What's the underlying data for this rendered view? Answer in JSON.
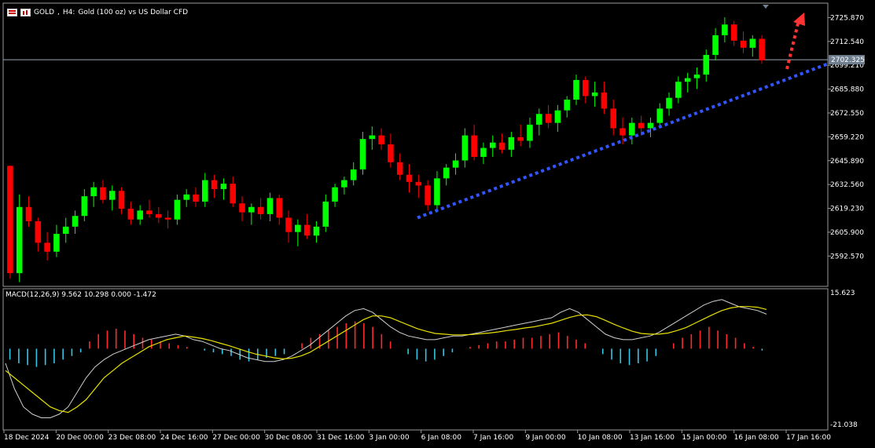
{
  "header": {
    "symbol": "GOLD",
    "timeframe": "H4:",
    "description": "Gold (100 oz) vs US Dollar CFD"
  },
  "chart_data": [
    {
      "type": "candlestick",
      "series_name": "GOLD",
      "ylim": [
        2580,
        2730
      ],
      "price_ticks": [
        "2725.870",
        "2712.540",
        "2699.210",
        "2685.880",
        "2672.550",
        "2659.220",
        "2645.890",
        "2632.560",
        "2619.230",
        "2605.900",
        "2592.570"
      ],
      "current_price": "2702.325",
      "x_tick_labels": [
        "18 Dec 2024",
        "20 Dec 00:00",
        "23 Dec 08:00",
        "24 Dec 16:00",
        "27 Dec 00:00",
        "30 Dec 08:00",
        "31 Dec 16:00",
        "3 Jan 00:00",
        "6 Jan 08:00",
        "7 Jan 16:00",
        "9 Jan 00:00",
        "10 Jan 08:00",
        "13 Jan 16:00",
        "15 Jan 00:00",
        "16 Jan 08:00",
        "17 Jan 16:00"
      ],
      "colors": {
        "bull": "#00ff00",
        "bear": "#ff0000",
        "trendline": "#3355ff",
        "arrow": "#ff3333"
      },
      "trendline": {
        "style": "dotted",
        "from_price": 2614,
        "to_price": 2700
      },
      "forecast_arrow": "up",
      "candles": [
        [
          2643,
          2643,
          2580,
          2583
        ],
        [
          2583,
          2627,
          2578,
          2620
        ],
        [
          2620,
          2626,
          2609,
          2612
        ],
        [
          2612,
          2614,
          2595,
          2600
        ],
        [
          2600,
          2606,
          2590,
          2595
        ],
        [
          2595,
          2610,
          2592,
          2605
        ],
        [
          2605,
          2614,
          2600,
          2609
        ],
        [
          2609,
          2618,
          2605,
          2615
        ],
        [
          2615,
          2630,
          2612,
          2626
        ],
        [
          2626,
          2634,
          2620,
          2631
        ],
        [
          2631,
          2635,
          2622,
          2624
        ],
        [
          2624,
          2632,
          2618,
          2629
        ],
        [
          2629,
          2631,
          2616,
          2619
        ],
        [
          2619,
          2623,
          2610,
          2613
        ],
        [
          2613,
          2621,
          2610,
          2618
        ],
        [
          2618,
          2624,
          2614,
          2616
        ],
        [
          2616,
          2620,
          2611,
          2614
        ],
        [
          2614,
          2618,
          2608,
          2613
        ],
        [
          2613,
          2627,
          2610,
          2624
        ],
        [
          2624,
          2630,
          2620,
          2627
        ],
        [
          2627,
          2631,
          2620,
          2623
        ],
        [
          2623,
          2639,
          2620,
          2635
        ],
        [
          2635,
          2638,
          2625,
          2630
        ],
        [
          2630,
          2636,
          2624,
          2633
        ],
        [
          2633,
          2637,
          2620,
          2622
        ],
        [
          2622,
          2626,
          2612,
          2617
        ],
        [
          2617,
          2622,
          2610,
          2620
        ],
        [
          2620,
          2625,
          2613,
          2616
        ],
        [
          2616,
          2628,
          2612,
          2625
        ],
        [
          2625,
          2627,
          2610,
          2614
        ],
        [
          2614,
          2618,
          2600,
          2606
        ],
        [
          2606,
          2613,
          2598,
          2610
        ],
        [
          2610,
          2616,
          2602,
          2604
        ],
        [
          2604,
          2612,
          2600,
          2609
        ],
        [
          2609,
          2627,
          2606,
          2623
        ],
        [
          2623,
          2633,
          2620,
          2631
        ],
        [
          2631,
          2637,
          2627,
          2635
        ],
        [
          2635,
          2645,
          2632,
          2641
        ],
        [
          2641,
          2662,
          2638,
          2658
        ],
        [
          2658,
          2665,
          2652,
          2660
        ],
        [
          2660,
          2664,
          2652,
          2655
        ],
        [
          2655,
          2661,
          2642,
          2645
        ],
        [
          2645,
          2650,
          2635,
          2638
        ],
        [
          2638,
          2644,
          2628,
          2634
        ],
        [
          2634,
          2638,
          2625,
          2632
        ],
        [
          2632,
          2635,
          2618,
          2621
        ],
        [
          2621,
          2640,
          2617,
          2636
        ],
        [
          2636,
          2644,
          2632,
          2642
        ],
        [
          2642,
          2650,
          2638,
          2646
        ],
        [
          2646,
          2664,
          2642,
          2660
        ],
        [
          2660,
          2666,
          2646,
          2648
        ],
        [
          2648,
          2656,
          2644,
          2653
        ],
        [
          2653,
          2660,
          2648,
          2656
        ],
        [
          2656,
          2661,
          2650,
          2652
        ],
        [
          2652,
          2662,
          2648,
          2659
        ],
        [
          2659,
          2666,
          2654,
          2657
        ],
        [
          2657,
          2670,
          2653,
          2666
        ],
        [
          2666,
          2675,
          2660,
          2672
        ],
        [
          2672,
          2677,
          2664,
          2667
        ],
        [
          2667,
          2677,
          2662,
          2674
        ],
        [
          2674,
          2682,
          2670,
          2680
        ],
        [
          2680,
          2694,
          2677,
          2691
        ],
        [
          2691,
          2693,
          2678,
          2682
        ],
        [
          2682,
          2690,
          2676,
          2684
        ],
        [
          2684,
          2690,
          2672,
          2675
        ],
        [
          2675,
          2680,
          2660,
          2664
        ],
        [
          2664,
          2670,
          2655,
          2660
        ],
        [
          2660,
          2670,
          2655,
          2667
        ],
        [
          2667,
          2671,
          2660,
          2664
        ],
        [
          2664,
          2670,
          2659,
          2667
        ],
        [
          2667,
          2678,
          2664,
          2675
        ],
        [
          2675,
          2684,
          2671,
          2681
        ],
        [
          2681,
          2693,
          2678,
          2690
        ],
        [
          2690,
          2695,
          2684,
          2692
        ],
        [
          2692,
          2698,
          2686,
          2694
        ],
        [
          2694,
          2708,
          2690,
          2705
        ],
        [
          2705,
          2720,
          2702,
          2716
        ],
        [
          2716,
          2726,
          2712,
          2722
        ],
        [
          2722,
          2724,
          2710,
          2713
        ],
        [
          2713,
          2718,
          2706,
          2709
        ],
        [
          2709,
          2716,
          2704,
          2714
        ],
        [
          2714,
          2716,
          2700,
          2702
        ]
      ]
    },
    {
      "type": "macd",
      "label": "MACD(12,26,9) 9.562 10.298 0.000 -1.472",
      "ylim": [
        -21.038,
        15.623
      ],
      "axis_ticks": [
        "15.623",
        "-21.038"
      ],
      "histogram": [
        -3,
        -4,
        -4.5,
        -5,
        -4.5,
        -4,
        -3,
        -2,
        -1,
        2,
        4,
        5,
        5.5,
        5,
        4,
        3,
        2.5,
        2,
        1.5,
        1,
        0.5,
        0,
        -0.5,
        -1,
        -1.5,
        -2,
        -3,
        -3.5,
        -3,
        -2.5,
        -2,
        -1.5,
        0,
        1.5,
        3,
        4,
        5,
        6,
        7,
        7.5,
        7,
        6,
        4,
        2,
        0,
        -1.5,
        -3,
        -3.5,
        -3,
        -2,
        -1,
        0,
        0.5,
        1,
        1.5,
        2,
        2,
        2.5,
        3,
        3,
        3.5,
        4,
        4.5,
        3.5,
        2.5,
        1.5,
        0,
        -1.5,
        -3,
        -4,
        -4.5,
        -4,
        -3.5,
        -2,
        0,
        1.5,
        3,
        4,
        5,
        6,
        5,
        4,
        3,
        1.5,
        0.5,
        -0.5
      ],
      "macd_line": [
        -4,
        -11,
        -16,
        -18,
        -19,
        -19,
        -18,
        -16,
        -12,
        -8,
        -5,
        -3,
        -1.5,
        -0.5,
        0.5,
        1.5,
        2.5,
        3,
        3.5,
        4,
        3.5,
        2.5,
        2,
        1,
        0,
        -0.5,
        -1.5,
        -2.5,
        -3,
        -3.5,
        -3.5,
        -3,
        -2,
        -0.5,
        1,
        3,
        5,
        7,
        9,
        10.5,
        11,
        10,
        8,
        6,
        4.5,
        3.5,
        3,
        2.5,
        2.5,
        3,
        3.5,
        3.5,
        4,
        4.5,
        5,
        5.5,
        6,
        6.5,
        7,
        7.5,
        8,
        8.5,
        10,
        11,
        10,
        8,
        6,
        4,
        3,
        2.5,
        2.5,
        3,
        3.5,
        4.5,
        6,
        7.5,
        9,
        10.5,
        12,
        13,
        13.5,
        12.5,
        11.5,
        11,
        10.5,
        9.5
      ],
      "signal_line": [
        -6,
        -8,
        -10,
        -12,
        -14,
        -16,
        -17,
        -17.5,
        -16,
        -14,
        -11,
        -8,
        -6,
        -4,
        -2.5,
        -1,
        0.5,
        1.5,
        2.5,
        3,
        3.5,
        3.2,
        2.8,
        2.2,
        1.5,
        0.8,
        0,
        -0.8,
        -1.5,
        -2,
        -2.5,
        -2.8,
        -2.6,
        -2,
        -1,
        0.5,
        2,
        3.5,
        5,
        6.5,
        8,
        9,
        9,
        8.5,
        7.5,
        6.5,
        5.5,
        4.8,
        4.2,
        4,
        3.8,
        3.8,
        3.9,
        4.1,
        4.3,
        4.6,
        5,
        5.3,
        5.7,
        6,
        6.5,
        7,
        7.8,
        8.6,
        9.2,
        9.3,
        8.8,
        7.8,
        6.7,
        5.7,
        4.8,
        4.2,
        4,
        4,
        4.3,
        5,
        5.8,
        7,
        8.2,
        9.4,
        10.5,
        11.2,
        11.6,
        11.6,
        11.4,
        10.8
      ]
    }
  ]
}
